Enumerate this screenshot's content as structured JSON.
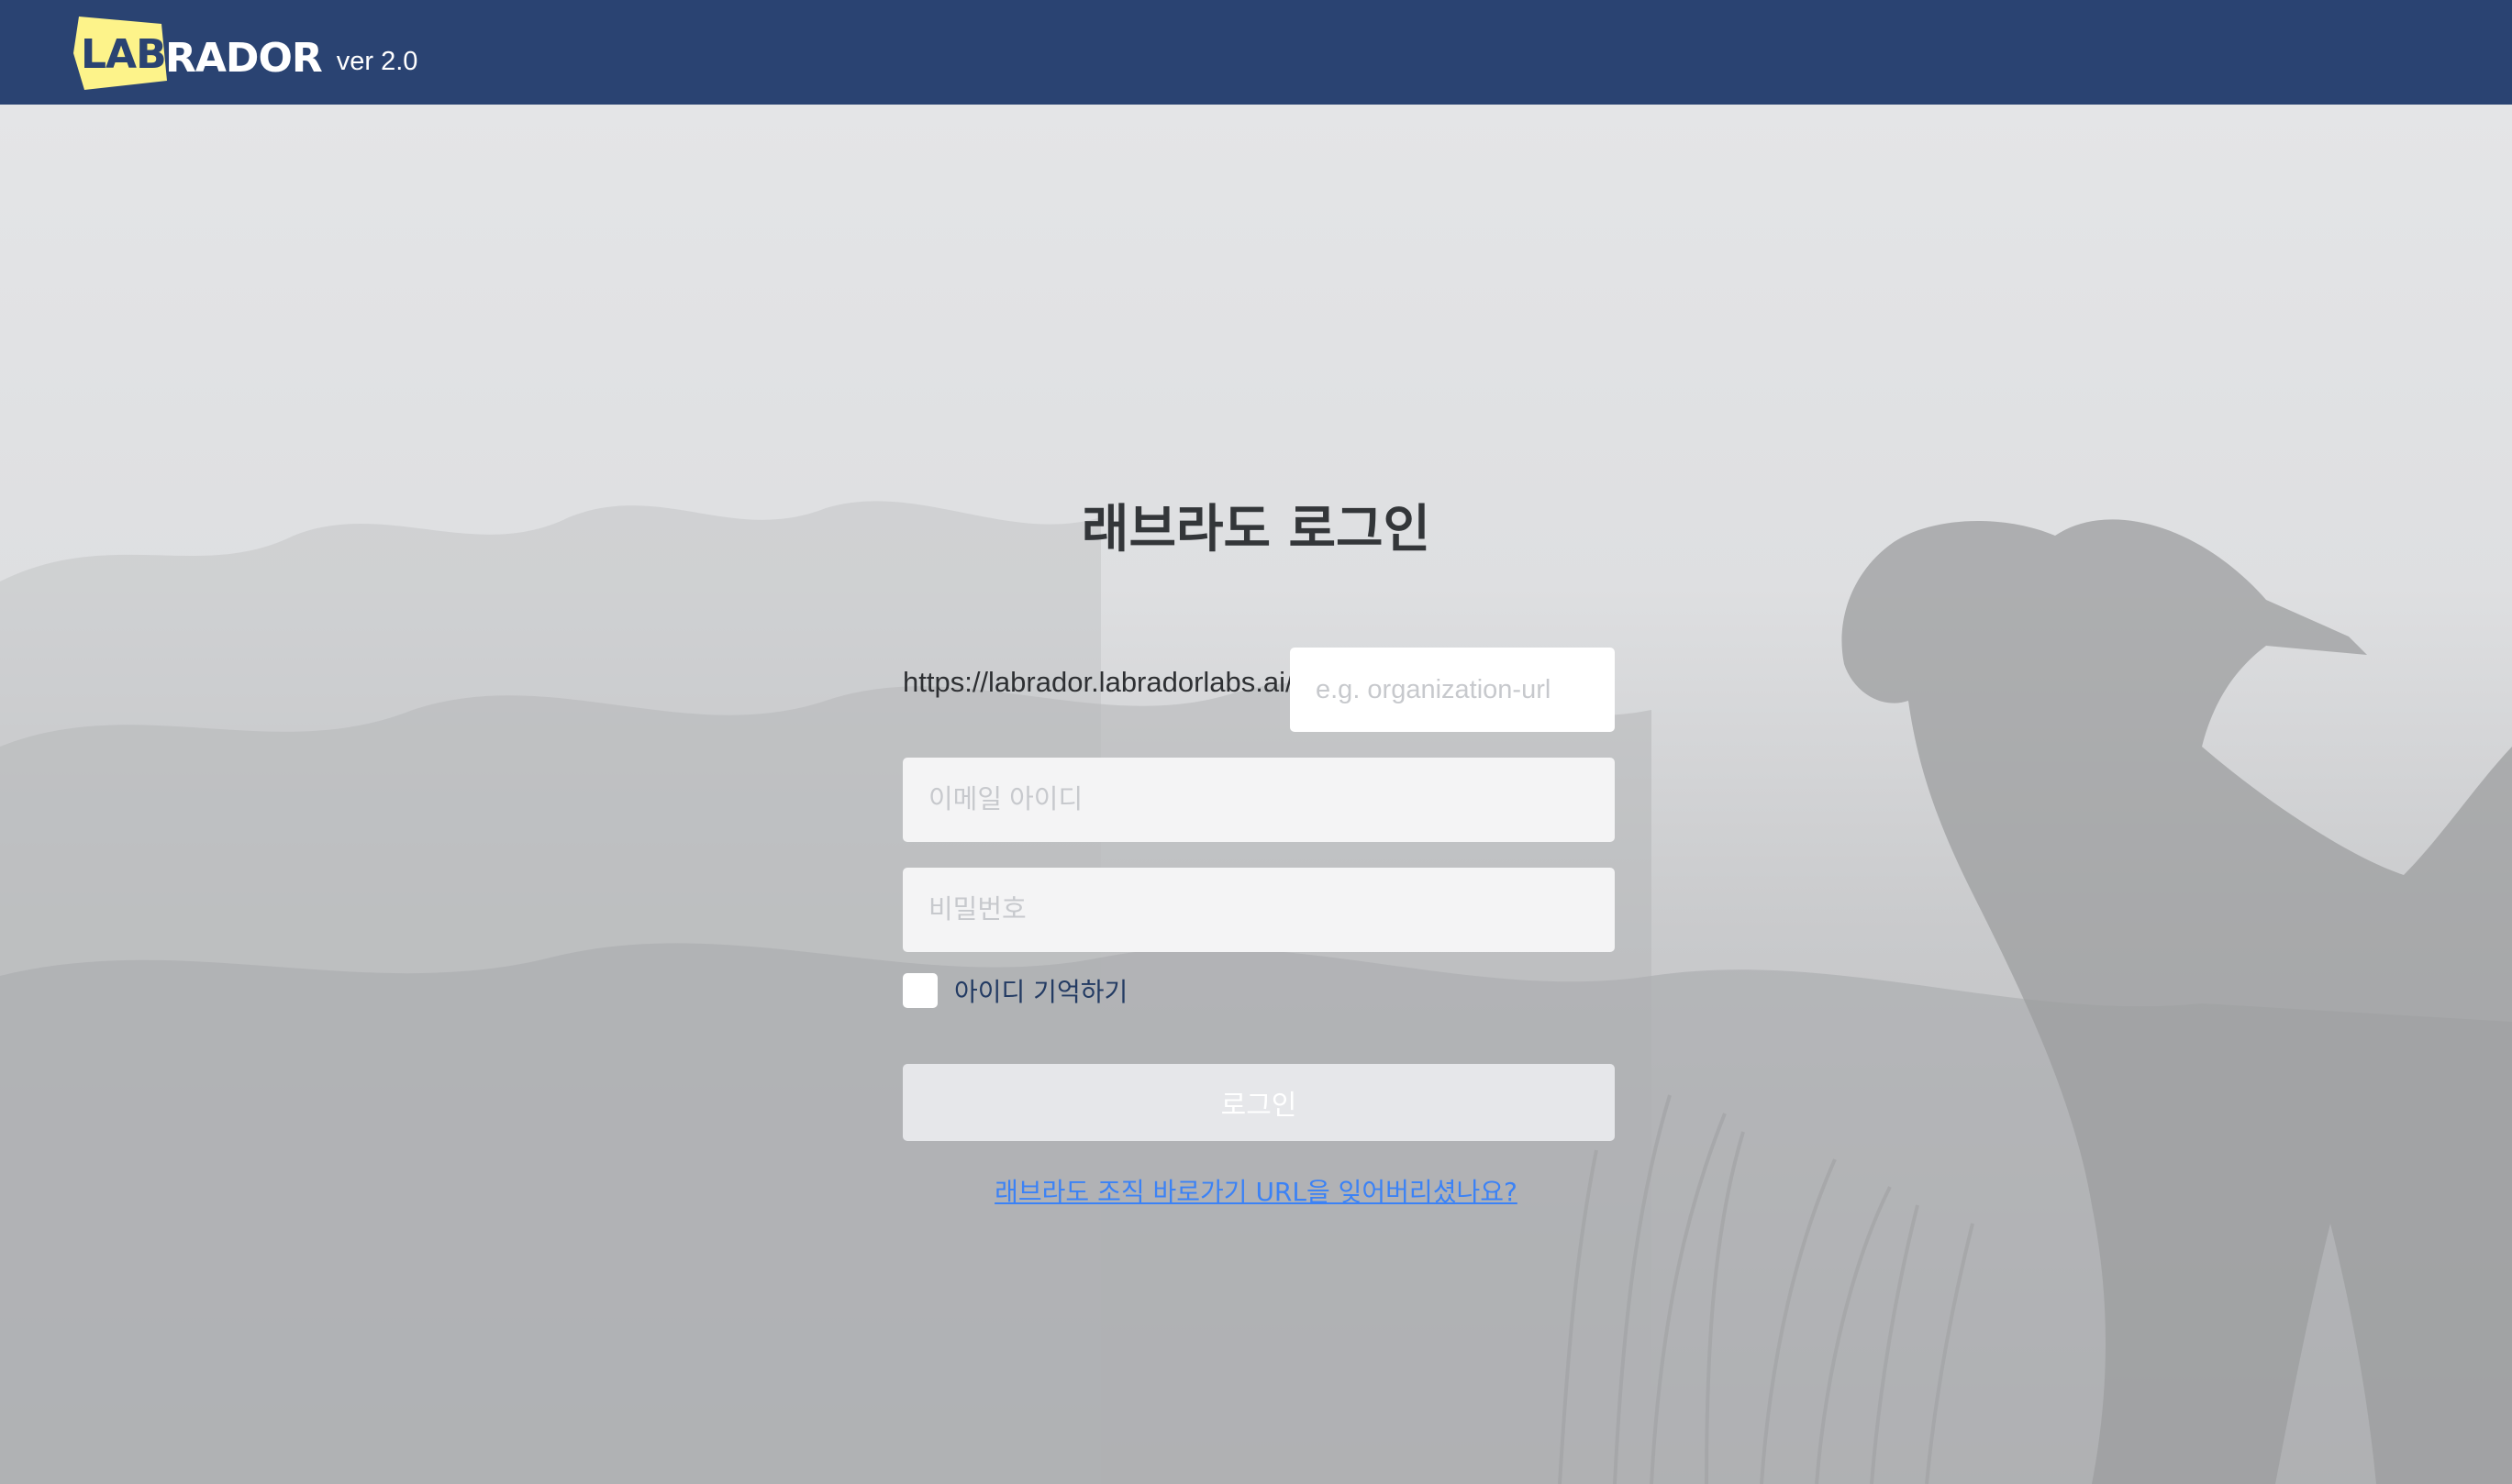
{
  "header": {
    "logo_lab": "LAB",
    "logo_rador": "RADOR",
    "version": "ver 2.0"
  },
  "login": {
    "title": "래브라도 로그인",
    "url_prefix": "https://labrador.labradorlabs.ai/",
    "org_placeholder": "e.g. organization-url",
    "email_placeholder": "이메일 아이디",
    "password_placeholder": "비밀번호",
    "remember_label": "아이디 기억하기",
    "remember_checked": false,
    "login_button": "로그인",
    "forgot_url_link": "래브라도 조직 바로가기 URL을 잊어버리셨나요?"
  },
  "colors": {
    "header_bg": "#2a4372",
    "logo_badge": "#fdf38a",
    "link": "#3b82f6",
    "button_bg": "#e6e7ea"
  }
}
